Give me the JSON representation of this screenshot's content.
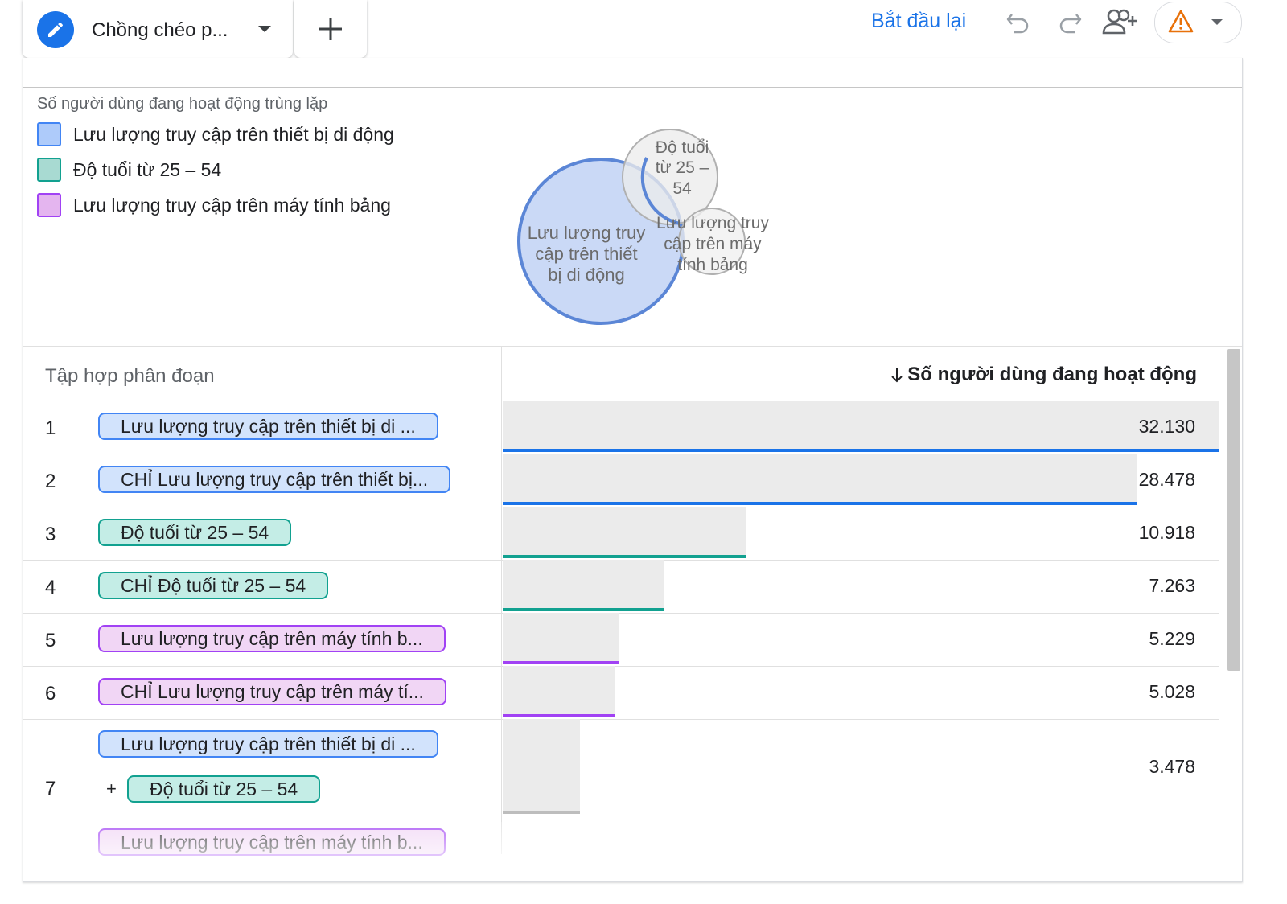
{
  "header": {
    "tab_title": "Chồng chéo p...",
    "add_tab_label": "+",
    "restart_label": "Bắt đầu lại",
    "icons": [
      "pencil-icon",
      "caret-down-icon",
      "plus-icon",
      "undo-icon",
      "redo-icon",
      "add-user-icon",
      "warning-icon",
      "caret-down-icon"
    ],
    "colors": {
      "accent": "#1a73e8",
      "warning": "#e8710a"
    }
  },
  "chart": {
    "title": "Số người dùng đang hoạt động trùng lặp",
    "legend": [
      {
        "label": "Lưu lượng truy cập trên thiết bị di động",
        "color": "#aecbfa",
        "border": "#4285f4"
      },
      {
        "label": "Độ tuổi từ 25 – 54",
        "color": "#a8dad2",
        "border": "#12a190"
      },
      {
        "label": "Lưu lượng truy cập trên máy tính bảng",
        "color": "#e4b5ef",
        "border": "#a142f4"
      }
    ],
    "venn_labels": {
      "mobile": [
        "Lưu lượng truy",
        "cập trên thiết",
        "bị di động"
      ],
      "age": [
        "Độ tuổi",
        "từ 25 –",
        "54"
      ],
      "tablet": [
        "Lưu lượng truy",
        "cập trên máy",
        "tính bảng"
      ]
    }
  },
  "chart_data": {
    "type": "table",
    "columns": [
      "Tập hợp phân đoạn",
      "Số người dùng đang hoạt động"
    ],
    "sort": "descending",
    "max_value": 32130,
    "rows": [
      {
        "num": "1",
        "segments": [
          {
            "label": "Lưu lượng truy cập trên thiết bị di ...",
            "color": "blue"
          }
        ],
        "value": 32130,
        "display": "32.130",
        "bar_color": "#1a73e8"
      },
      {
        "num": "2",
        "segments": [
          {
            "label": "CHỈ Lưu lượng truy cập trên thiết bị...",
            "color": "blue"
          }
        ],
        "value": 28478,
        "display": "28.478",
        "bar_color": "#1a73e8"
      },
      {
        "num": "3",
        "segments": [
          {
            "label": "Độ tuổi từ 25 – 54",
            "color": "teal"
          }
        ],
        "value": 10918,
        "display": "10.918",
        "bar_color": "#12a190"
      },
      {
        "num": "4",
        "segments": [
          {
            "label": "CHỈ Độ tuổi từ 25 – 54",
            "color": "teal"
          }
        ],
        "value": 7263,
        "display": "7.263",
        "bar_color": "#12a190"
      },
      {
        "num": "5",
        "segments": [
          {
            "label": "Lưu lượng truy cập trên máy tính b...",
            "color": "purple"
          }
        ],
        "value": 5229,
        "display": "5.229",
        "bar_color": "#a142f4"
      },
      {
        "num": "6",
        "segments": [
          {
            "label": "CHỈ Lưu lượng truy cập trên máy tí...",
            "color": "purple"
          }
        ],
        "value": 5028,
        "display": "5.028",
        "bar_color": "#a142f4"
      },
      {
        "num": "7",
        "segments": [
          {
            "label": "Lưu lượng truy cập trên thiết bị di ...",
            "color": "blue"
          },
          {
            "label": "Độ tuổi từ 25 – 54",
            "color": "teal",
            "prefix": "+"
          }
        ],
        "value": 3478,
        "display": "3.478",
        "bar_color": "#bdbdbd"
      }
    ],
    "partial_row": {
      "segments": [
        {
          "label": "Lưu lượng truy cập trên máy tính b...",
          "color": "purple"
        }
      ]
    }
  }
}
